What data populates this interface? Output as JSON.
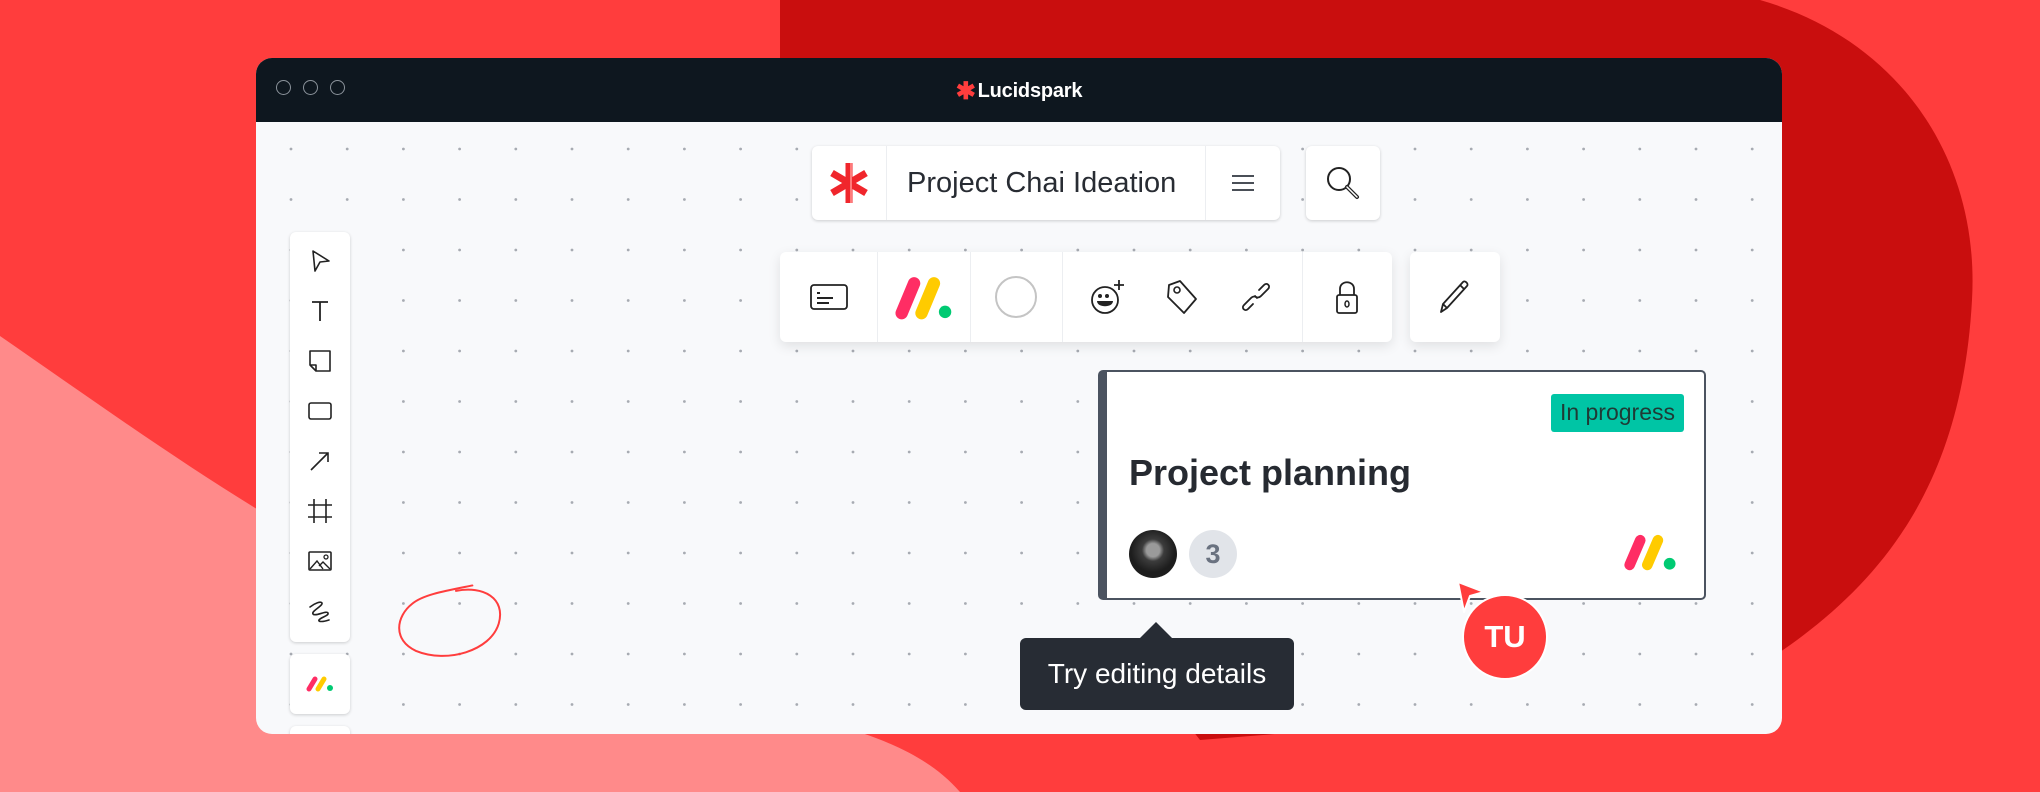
{
  "window": {
    "app_name": "Lucidspark",
    "traffic_lights": [
      "close",
      "minimize",
      "maximize"
    ]
  },
  "colors": {
    "brand_red": "#ff3d3d",
    "dark_red": "#c90e0e",
    "pink": "#ff8a8a",
    "titlebar": "#0e171f",
    "canvas": "#f8f9fb",
    "status_teal": "#00c5a5",
    "monday_red": "#ff2d64",
    "monday_yellow": "#ffcb00",
    "monday_green": "#00ca72"
  },
  "document": {
    "title": "Project Chai Ideation",
    "logo_icon": "lucidspark-asterisk-icon",
    "menu_icon": "hamburger-menu-icon",
    "search_icon": "search-icon"
  },
  "left_toolbar": {
    "tools": [
      {
        "name": "select",
        "icon": "pointer-icon"
      },
      {
        "name": "text",
        "icon": "text-icon"
      },
      {
        "name": "sticky note",
        "icon": "sticky-note-icon"
      },
      {
        "name": "shape",
        "icon": "rectangle-icon"
      },
      {
        "name": "line",
        "icon": "arrow-icon"
      },
      {
        "name": "frame",
        "icon": "frame-icon"
      },
      {
        "name": "image",
        "icon": "image-icon"
      },
      {
        "name": "freehand",
        "icon": "freehand-icon"
      }
    ],
    "integration_icon": "monday-logo-icon",
    "more_icon": "more-dots-icon"
  },
  "context_toolbar": {
    "items": [
      {
        "name": "card details",
        "icon": "card-details-icon"
      },
      {
        "name": "monday.com",
        "icon": "monday-logo-icon"
      },
      {
        "name": "color",
        "icon": "color-circle-icon"
      },
      {
        "name": "add reaction",
        "icon": "emoji-add-icon"
      },
      {
        "name": "tag",
        "icon": "tag-icon"
      },
      {
        "name": "link",
        "icon": "link-icon"
      },
      {
        "name": "lock",
        "icon": "lock-icon"
      },
      {
        "name": "edit",
        "icon": "pencil-icon"
      }
    ]
  },
  "card": {
    "title": "Project planning",
    "status": "In progress",
    "assignee_count": "3"
  },
  "tooltip": {
    "text": "Try editing details"
  },
  "collaborator": {
    "initials": "TU"
  }
}
